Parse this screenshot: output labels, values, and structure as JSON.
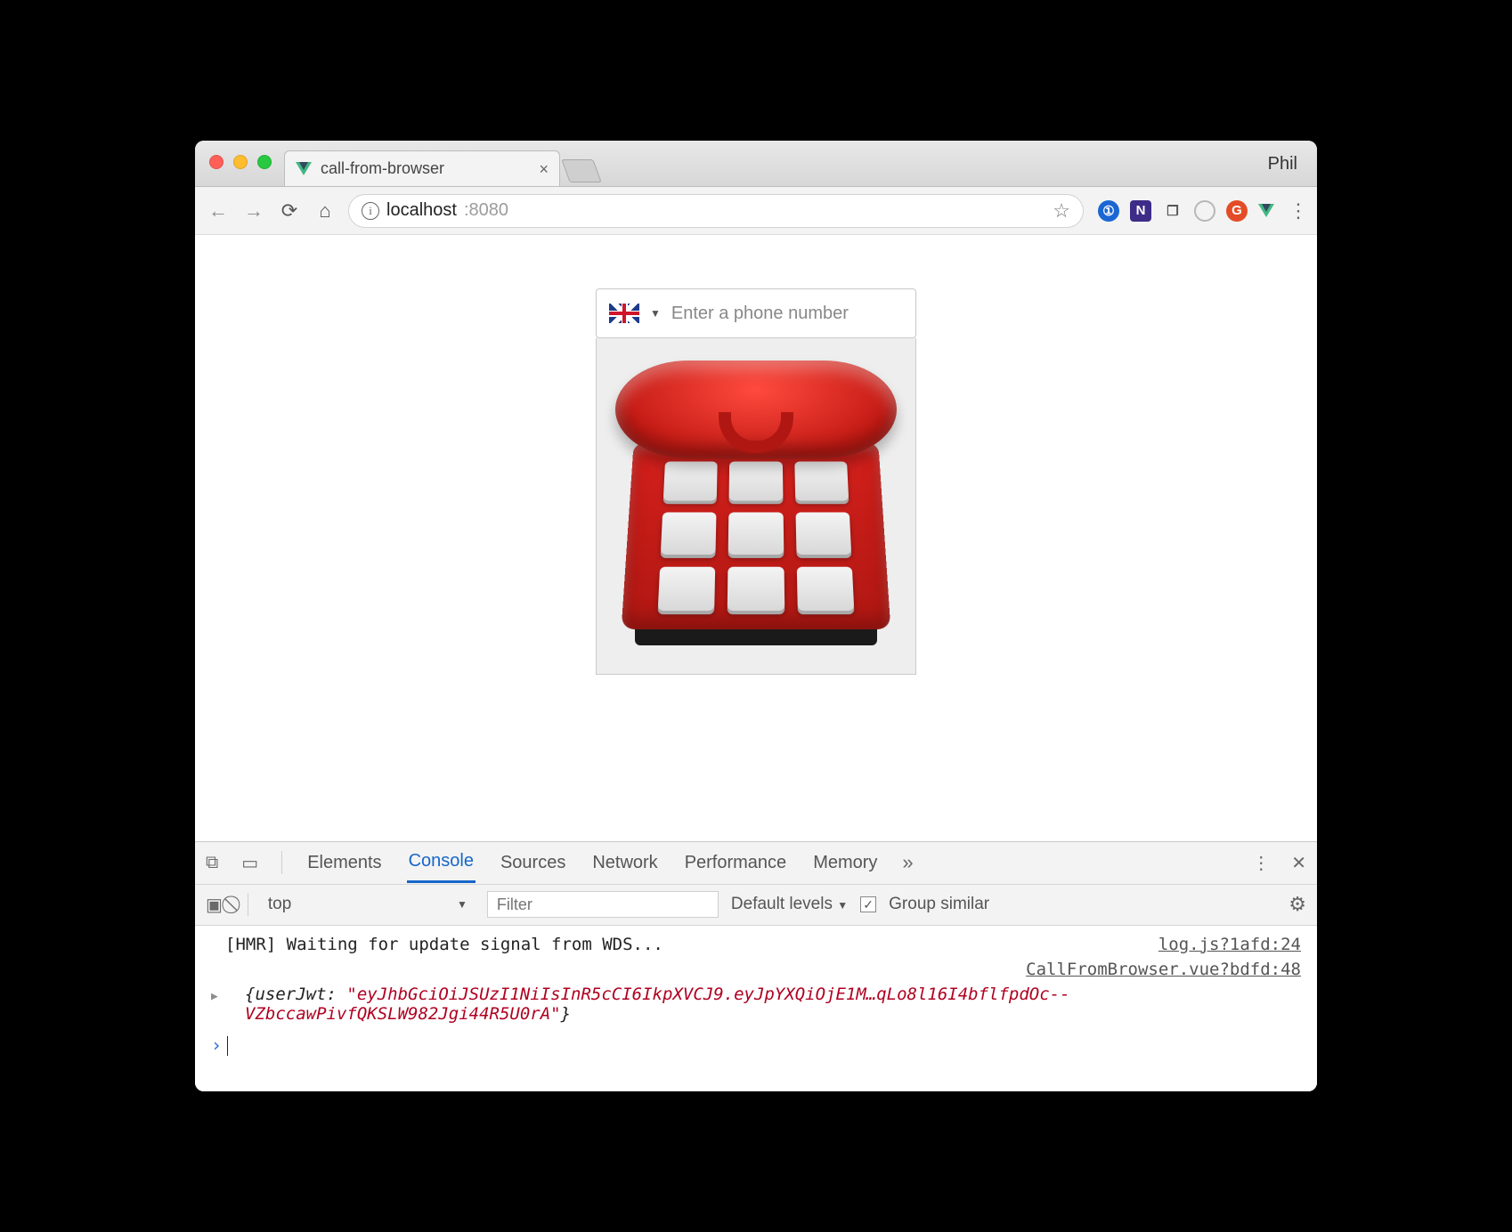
{
  "chrome": {
    "profile_name": "Phil",
    "tab_title": "call-from-browser",
    "address_host": "localhost",
    "address_port": ":8080"
  },
  "page": {
    "phone_placeholder": "Enter a phone number",
    "country_flag": "uk"
  },
  "devtools": {
    "tabs": [
      "Elements",
      "Console",
      "Sources",
      "Network",
      "Performance",
      "Memory"
    ],
    "active_tab_index": 1,
    "context": "top",
    "filter_placeholder": "Filter",
    "levels_label": "Default levels",
    "group_similar_label": "Group similar",
    "group_similar_checked": true,
    "log": [
      {
        "text": "[HMR] Waiting for update signal from WDS...",
        "source": "log.js?1afd:24"
      }
    ],
    "object_log": {
      "source": "CallFromBrowser.vue?bdfd:48",
      "prefix": "{userJwt: ",
      "value": "\"eyJhbGciOiJSUzI1NiIsInR5cCI6IkpXVCJ9.eyJpYXQiOjE1M…qLo8l16I4bflfpdOc--VZbccawPivfQKSLW982Jgi44R5U0rA\"",
      "suffix": "}"
    }
  }
}
